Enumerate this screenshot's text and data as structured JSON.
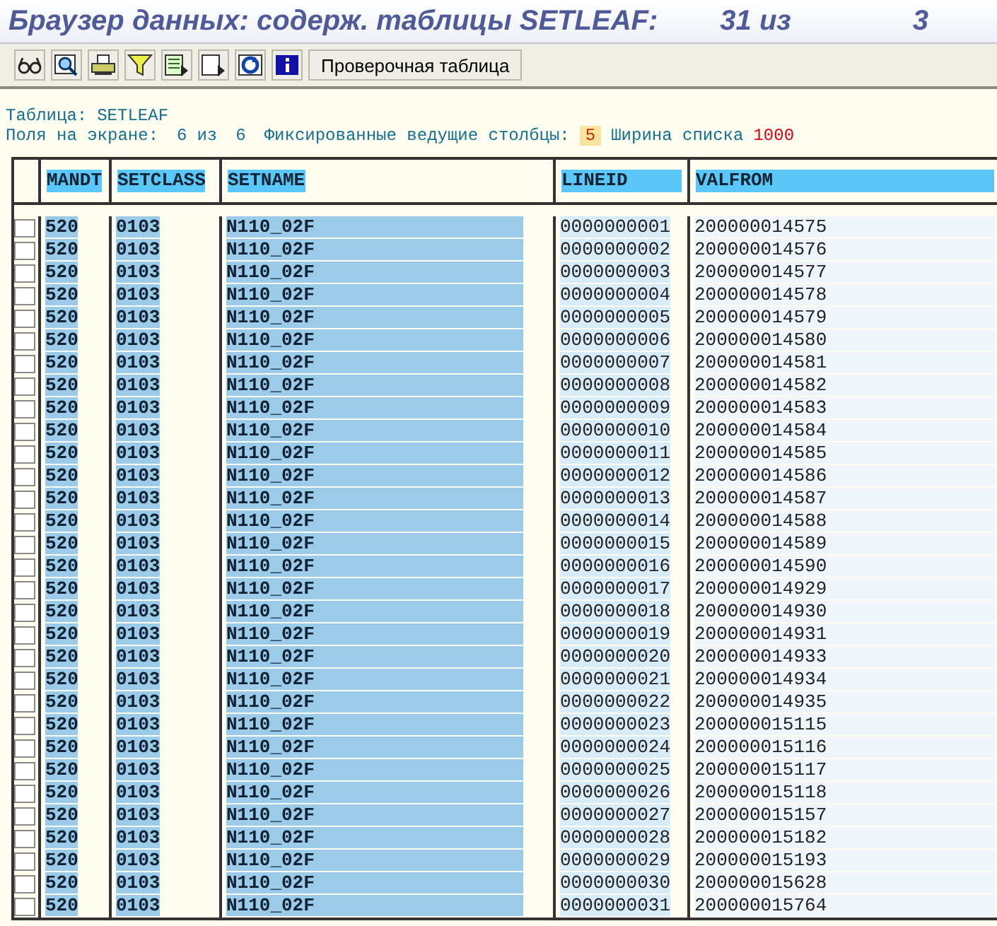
{
  "window": {
    "title": "Браузер данных: содерж. таблицы SETLEAF:",
    "count": "31 из",
    "count_cut": "3"
  },
  "toolbar": {
    "button": "Проверочная таблица"
  },
  "info": {
    "table_label": "Таблица:",
    "table_name": "SETLEAF",
    "fields_label": "Поля на экране:",
    "fields_shown": "6",
    "fields_of": "из",
    "fields_total": "6",
    "fixed_label": "Фиксированные ведущие столбцы:",
    "fixed_value": "5",
    "width_label": "Ширина списка",
    "width_value": "1000"
  },
  "table": {
    "columns": [
      {
        "label": "MANDT",
        "kind": "key"
      },
      {
        "label": "SETCLASS",
        "kind": "key"
      },
      {
        "label": "SETNAME",
        "kind": "key"
      },
      {
        "label": "LINEID",
        "kind": "lead"
      },
      {
        "label": "VALFROM",
        "kind": "plain"
      }
    ],
    "rows": [
      {
        "selected": false,
        "cells": [
          "520",
          "0103",
          "N110_02F",
          "0000000001",
          "200000014575"
        ]
      },
      {
        "selected": false,
        "cells": [
          "520",
          "0103",
          "N110_02F",
          "0000000002",
          "200000014576"
        ]
      },
      {
        "selected": false,
        "cells": [
          "520",
          "0103",
          "N110_02F",
          "0000000003",
          "200000014577"
        ]
      },
      {
        "selected": false,
        "cells": [
          "520",
          "0103",
          "N110_02F",
          "0000000004",
          "200000014578"
        ]
      },
      {
        "selected": false,
        "cells": [
          "520",
          "0103",
          "N110_02F",
          "0000000005",
          "200000014579"
        ]
      },
      {
        "selected": false,
        "cells": [
          "520",
          "0103",
          "N110_02F",
          "0000000006",
          "200000014580"
        ]
      },
      {
        "selected": false,
        "cells": [
          "520",
          "0103",
          "N110_02F",
          "0000000007",
          "200000014581"
        ]
      },
      {
        "selected": false,
        "cells": [
          "520",
          "0103",
          "N110_02F",
          "0000000008",
          "200000014582"
        ]
      },
      {
        "selected": false,
        "cells": [
          "520",
          "0103",
          "N110_02F",
          "0000000009",
          "200000014583"
        ]
      },
      {
        "selected": false,
        "cells": [
          "520",
          "0103",
          "N110_02F",
          "0000000010",
          "200000014584"
        ]
      },
      {
        "selected": false,
        "cells": [
          "520",
          "0103",
          "N110_02F",
          "0000000011",
          "200000014585"
        ]
      },
      {
        "selected": false,
        "cells": [
          "520",
          "0103",
          "N110_02F",
          "0000000012",
          "200000014586"
        ]
      },
      {
        "selected": false,
        "cells": [
          "520",
          "0103",
          "N110_02F",
          "0000000013",
          "200000014587"
        ]
      },
      {
        "selected": false,
        "cells": [
          "520",
          "0103",
          "N110_02F",
          "0000000014",
          "200000014588"
        ]
      },
      {
        "selected": false,
        "cells": [
          "520",
          "0103",
          "N110_02F",
          "0000000015",
          "200000014589"
        ]
      },
      {
        "selected": false,
        "cells": [
          "520",
          "0103",
          "N110_02F",
          "0000000016",
          "200000014590"
        ]
      },
      {
        "selected": false,
        "cells": [
          "520",
          "0103",
          "N110_02F",
          "0000000017",
          "200000014929"
        ]
      },
      {
        "selected": false,
        "cells": [
          "520",
          "0103",
          "N110_02F",
          "0000000018",
          "200000014930"
        ]
      },
      {
        "selected": false,
        "cells": [
          "520",
          "0103",
          "N110_02F",
          "0000000019",
          "200000014931"
        ]
      },
      {
        "selected": false,
        "cells": [
          "520",
          "0103",
          "N110_02F",
          "0000000020",
          "200000014933"
        ]
      },
      {
        "selected": false,
        "cells": [
          "520",
          "0103",
          "N110_02F",
          "0000000021",
          "200000014934"
        ]
      },
      {
        "selected": false,
        "cells": [
          "520",
          "0103",
          "N110_02F",
          "0000000022",
          "200000014935"
        ]
      },
      {
        "selected": false,
        "cells": [
          "520",
          "0103",
          "N110_02F",
          "0000000023",
          "200000015115"
        ]
      },
      {
        "selected": false,
        "cells": [
          "520",
          "0103",
          "N110_02F",
          "0000000024",
          "200000015116"
        ]
      },
      {
        "selected": false,
        "cells": [
          "520",
          "0103",
          "N110_02F",
          "0000000025",
          "200000015117"
        ]
      },
      {
        "selected": false,
        "cells": [
          "520",
          "0103",
          "N110_02F",
          "0000000026",
          "200000015118"
        ]
      },
      {
        "selected": false,
        "cells": [
          "520",
          "0103",
          "N110_02F",
          "0000000027",
          "200000015157"
        ]
      },
      {
        "selected": false,
        "cells": [
          "520",
          "0103",
          "N110_02F",
          "0000000028",
          "200000015182"
        ]
      },
      {
        "selected": false,
        "cells": [
          "520",
          "0103",
          "N110_02F",
          "0000000029",
          "200000015193"
        ]
      },
      {
        "selected": false,
        "cells": [
          "520",
          "0103",
          "N110_02F",
          "0000000030",
          "200000015628"
        ]
      },
      {
        "selected": false,
        "cells": [
          "520",
          "0103",
          "N110_02F",
          "0000000031",
          "200000015764"
        ]
      }
    ]
  }
}
